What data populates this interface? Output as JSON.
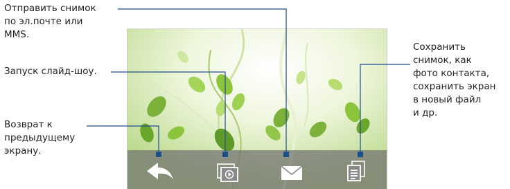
{
  "callouts": {
    "send": "Отправить снимок\nпо эл.почте или\nMMS.",
    "slideshow": "Запуск слайд-шоу.",
    "back": "Возврат к\nпредыдущему\nэкрану.",
    "save": "Сохранить\nснимок, как\nфото контакта,\nсохранить экран\nв новый файл\nи др."
  },
  "toolbar": {
    "buttons": [
      {
        "id": "back",
        "icon": "back-arrow-icon"
      },
      {
        "id": "slideshow",
        "icon": "slideshow-icon"
      },
      {
        "id": "send",
        "icon": "envelope-icon"
      },
      {
        "id": "menu",
        "icon": "menu-list-icon"
      }
    ]
  },
  "colors": {
    "leader_line": "#1f4e8c",
    "toolbar_overlay": "#707070",
    "leaf_green": "#7fb43a"
  }
}
